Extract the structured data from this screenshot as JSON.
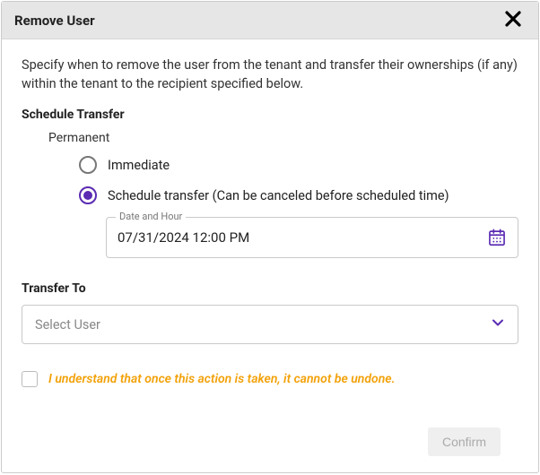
{
  "dialog": {
    "title": "Remove User",
    "description": "Specify when to remove the user from the tenant and transfer their ownerships (if any) within the tenant to the recipient specified below."
  },
  "schedule": {
    "heading": "Schedule Transfer",
    "subheading": "Permanent",
    "options": {
      "immediate": "Immediate",
      "scheduled": "Schedule transfer (Can be canceled before scheduled time)"
    },
    "selected": "scheduled",
    "date_field": {
      "label": "Date and Hour",
      "value": "07/31/2024 12:00 PM"
    }
  },
  "transfer": {
    "heading": "Transfer To",
    "placeholder": "Select User"
  },
  "acknowledge": {
    "text": "I understand that once this action is taken, it cannot be undone.",
    "checked": false
  },
  "actions": {
    "confirm_label": "Confirm",
    "confirm_enabled": false
  },
  "colors": {
    "accent": "#5b2bb3",
    "warning": "#f2a108"
  }
}
